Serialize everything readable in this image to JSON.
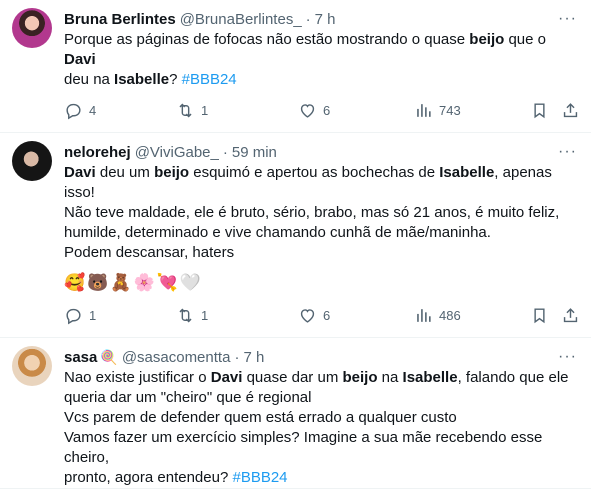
{
  "tweets": [
    {
      "name": "Bruna Berlintes",
      "handle": "@BrunaBerlintes_",
      "time": "7 h",
      "emoji": "",
      "lines": [
        [
          {
            "t": "Porque as páginas de fofocas não estão mostrando o quase "
          },
          {
            "t": "beijo",
            "b": true
          },
          {
            "t": " que o "
          },
          {
            "t": "Davi",
            "b": true
          }
        ],
        [
          {
            "t": "deu na "
          },
          {
            "t": "Isabelle",
            "b": true
          },
          {
            "t": "? "
          },
          {
            "t": "#BBB24",
            "tag": true
          }
        ]
      ],
      "emojis": "",
      "replies": "4",
      "retweets": "1",
      "likes": "6",
      "views": "743"
    },
    {
      "name": "nelorehej",
      "handle": "@ViviGabe_",
      "time": "59 min",
      "emoji": "",
      "lines": [
        [
          {
            "t": "Davi",
            "b": true
          },
          {
            "t": " deu um "
          },
          {
            "t": "beijo",
            "b": true
          },
          {
            "t": " esquimó e apertou as bochechas de "
          },
          {
            "t": "Isabelle",
            "b": true
          },
          {
            "t": ", apenas isso!"
          }
        ],
        [
          {
            "t": "Não teve maldade, ele é bruto, sério, brabo, mas só 21 anos, é muito feliz,"
          }
        ],
        [
          {
            "t": "humilde, determinado e vive chamando cunhã de mãe/maninha."
          }
        ],
        [
          {
            "t": "Podem descansar, haters"
          }
        ]
      ],
      "emojis": "🥰🐻🧸🌸💘🤍",
      "replies": "1",
      "retweets": "1",
      "likes": "6",
      "views": "486"
    },
    {
      "name": "sasa",
      "handle": "@sasacomentta",
      "time": "7 h",
      "emoji": "🍭",
      "lines": [
        [
          {
            "t": "Nao existe justificar o "
          },
          {
            "t": "Davi",
            "b": true
          },
          {
            "t": " quase dar um "
          },
          {
            "t": "beijo",
            "b": true
          },
          {
            "t": " na "
          },
          {
            "t": "Isabelle",
            "b": true
          },
          {
            "t": ", falando que ele"
          }
        ],
        [
          {
            "t": "queria dar um \"cheiro\" que é regional"
          }
        ],
        [
          {
            "t": "Vcs parem de defender quem está errado a qualquer custo"
          }
        ],
        [
          {
            "t": "Vamos fazer um exercício simples? Imagine a sua mãe recebendo esse cheiro,"
          }
        ],
        [
          {
            "t": "pronto, agora entendeu? "
          },
          {
            "t": "#BBB24",
            "tag": true
          }
        ]
      ],
      "emojis": "",
      "replies": "",
      "retweets": "",
      "likes": "",
      "views": ""
    }
  ]
}
